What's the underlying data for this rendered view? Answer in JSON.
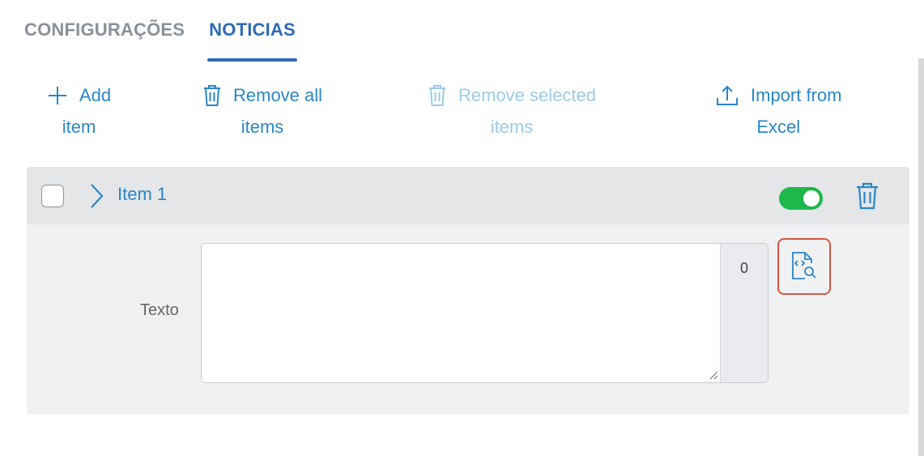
{
  "tabs": [
    {
      "label": "CONFIGURAÇÕES",
      "active": false
    },
    {
      "label": "NOTICIAS",
      "active": true
    }
  ],
  "toolbar": {
    "add": {
      "line1": "Add",
      "line2": "item",
      "icon": "plus-icon"
    },
    "remove_all": {
      "line1": "Remove all",
      "line2": "items",
      "icon": "trash-icon"
    },
    "remove_selected": {
      "line1": "Remove selected",
      "line2": "items",
      "icon": "trash-icon",
      "disabled": true
    },
    "import_excel": {
      "line1": "Import from",
      "line2": "Excel",
      "icon": "upload-icon"
    }
  },
  "item": {
    "title": "Item 1",
    "checked": false,
    "enabled": true,
    "field": {
      "label": "Texto",
      "value": "",
      "char_count": "0"
    },
    "preview_icon": "code-preview-icon"
  },
  "colors": {
    "accent_blue": "#2a86c7",
    "tab_active": "#2e6ab7",
    "toggle_on": "#1db84b",
    "highlight": "#d9553f"
  }
}
